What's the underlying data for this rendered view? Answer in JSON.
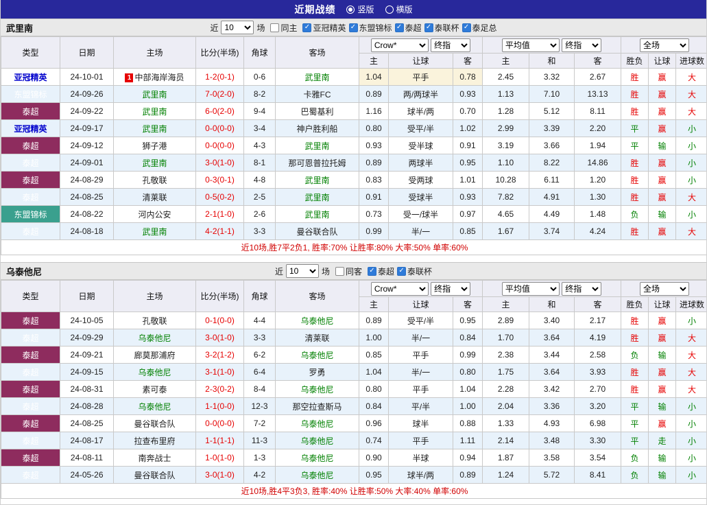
{
  "title_bar": {
    "title": "近期战绩",
    "options": [
      {
        "label": "竖版",
        "checked": true
      },
      {
        "label": "横版",
        "checked": false
      }
    ]
  },
  "colors": {
    "titlebar_bg": "#28289b",
    "thai_league_bg": "#8e2c5e",
    "asean_league_bg": "#3aa08e",
    "afc_league_text": "#0000cc",
    "focus_team_green": "#008000",
    "win_red": "#e60000",
    "lose_green": "#008000",
    "alt_row_bg": "#e8f2fb",
    "highlight_bg": "#faf3dc",
    "summary_red": "#d10000"
  },
  "sections": [
    {
      "team": "武里南",
      "filter": {
        "recent_label": "近",
        "recent_value": "10",
        "games_label": "场",
        "same_venue": {
          "label": "同主",
          "checked": false
        },
        "leagues": [
          {
            "label": "亚冠精英",
            "checked": true
          },
          {
            "label": "东盟锦标",
            "checked": true
          },
          {
            "label": "泰超",
            "checked": true
          },
          {
            "label": "泰联杯",
            "checked": true
          },
          {
            "label": "泰足总",
            "checked": true
          }
        ]
      },
      "header": {
        "type": "类型",
        "date": "日期",
        "home": "主场",
        "score": "比分(半场)",
        "corner": "角球",
        "away": "客场",
        "odds_select": "Crow*",
        "odds_close": "终指",
        "avg_select": "平均值",
        "avg_close": "终指",
        "full_select": "全场",
        "sub": [
          "主",
          "让球",
          "客",
          "主",
          "和",
          "客",
          "胜负",
          "让球",
          "进球数"
        ]
      },
      "rows": [
        {
          "league": "亚冠精英",
          "league_class": "afc",
          "date": "24-10-01",
          "badge": "1",
          "home": "中部海岸海员",
          "score": "1-2(0-1)",
          "corners": "0-6",
          "away": "武里南",
          "odds": [
            "1.04",
            "平手",
            "0.78"
          ],
          "avg": [
            "2.45",
            "3.32",
            "2.67"
          ],
          "results": [
            "胜",
            "赢",
            "大"
          ],
          "highlight": true
        },
        {
          "league": "东盟锦标",
          "league_class": "asean",
          "date": "24-09-26",
          "home": "武里南",
          "score": "7-0(2-0)",
          "corners": "8-2",
          "away": "卡雅FC",
          "odds": [
            "0.89",
            "两/两球半",
            "0.93"
          ],
          "avg": [
            "1.13",
            "7.10",
            "13.13"
          ],
          "results": [
            "胜",
            "赢",
            "大"
          ]
        },
        {
          "league": "泰超",
          "league_class": "thai",
          "date": "24-09-22",
          "home": "武里南",
          "score": "6-0(2-0)",
          "corners": "9-4",
          "away": "巴蜀基利",
          "odds": [
            "1.16",
            "球半/两",
            "0.70"
          ],
          "avg": [
            "1.28",
            "5.12",
            "8.11"
          ],
          "results": [
            "胜",
            "赢",
            "大"
          ]
        },
        {
          "league": "亚冠精英",
          "league_class": "afc",
          "date": "24-09-17",
          "home": "武里南",
          "score": "0-0(0-0)",
          "corners": "3-4",
          "away": "神户胜利船",
          "odds": [
            "0.80",
            "受平/半",
            "1.02"
          ],
          "avg": [
            "2.99",
            "3.39",
            "2.20"
          ],
          "results": [
            "平",
            "赢",
            "小"
          ]
        },
        {
          "league": "泰超",
          "league_class": "thai",
          "date": "24-09-12",
          "home": "狮子港",
          "score": "0-0(0-0)",
          "corners": "4-3",
          "away": "武里南",
          "odds": [
            "0.93",
            "受半球",
            "0.91"
          ],
          "avg": [
            "3.19",
            "3.66",
            "1.94"
          ],
          "results": [
            "平",
            "输",
            "小"
          ]
        },
        {
          "league": "泰超",
          "league_class": "thai",
          "date": "24-09-01",
          "home": "武里南",
          "score": "3-0(1-0)",
          "corners": "8-1",
          "away": "那可恩普拉托姆",
          "odds": [
            "0.89",
            "两球半",
            "0.95"
          ],
          "avg": [
            "1.10",
            "8.22",
            "14.86"
          ],
          "results": [
            "胜",
            "赢",
            "小"
          ]
        },
        {
          "league": "泰超",
          "league_class": "thai",
          "date": "24-08-29",
          "home": "孔敬联",
          "score": "0-3(0-1)",
          "corners": "4-8",
          "away": "武里南",
          "odds": [
            "0.83",
            "受两球",
            "1.01"
          ],
          "avg": [
            "10.28",
            "6.11",
            "1.20"
          ],
          "results": [
            "胜",
            "赢",
            "小"
          ]
        },
        {
          "league": "泰超",
          "league_class": "thai",
          "date": "24-08-25",
          "home": "清莱联",
          "score": "0-5(0-2)",
          "corners": "2-5",
          "away": "武里南",
          "odds": [
            "0.91",
            "受球半",
            "0.93"
          ],
          "avg": [
            "7.82",
            "4.91",
            "1.30"
          ],
          "results": [
            "胜",
            "赢",
            "大"
          ]
        },
        {
          "league": "东盟锦标",
          "league_class": "asean",
          "date": "24-08-22",
          "home": "河内公安",
          "score": "2-1(1-0)",
          "corners": "2-6",
          "away": "武里南",
          "odds": [
            "0.73",
            "受一/球半",
            "0.97"
          ],
          "avg": [
            "4.65",
            "4.49",
            "1.48"
          ],
          "results": [
            "负",
            "输",
            "小"
          ]
        },
        {
          "league": "泰超",
          "league_class": "thai",
          "date": "24-08-18",
          "home": "武里南",
          "score": "4-2(1-1)",
          "corners": "3-3",
          "away": "曼谷联合队",
          "odds": [
            "0.99",
            "半/一",
            "0.85"
          ],
          "avg": [
            "1.67",
            "3.74",
            "4.24"
          ],
          "results": [
            "胜",
            "赢",
            "大"
          ]
        }
      ],
      "summary": "近10场,胜7平2负1, 胜率:70% 让胜率:80% 大率:50% 单率:60%"
    },
    {
      "team": "乌泰他尼",
      "filter": {
        "recent_label": "近",
        "recent_value": "10",
        "games_label": "场",
        "same_venue": {
          "label": "同客",
          "checked": false
        },
        "leagues": [
          {
            "label": "泰超",
            "checked": true
          },
          {
            "label": "泰联杯",
            "checked": true
          }
        ]
      },
      "header": {
        "type": "类型",
        "date": "日期",
        "home": "主场",
        "score": "比分(半场)",
        "corner": "角球",
        "away": "客场",
        "odds_select": "Crow*",
        "odds_close": "终指",
        "avg_select": "平均值",
        "avg_close": "终指",
        "full_select": "全场",
        "sub": [
          "主",
          "让球",
          "客",
          "主",
          "和",
          "客",
          "胜负",
          "让球",
          "进球数"
        ]
      },
      "rows": [
        {
          "league": "泰超",
          "league_class": "thai",
          "date": "24-10-05",
          "home": "孔敬联",
          "score": "0-1(0-0)",
          "corners": "4-4",
          "away": "乌泰他尼",
          "odds": [
            "0.89",
            "受平/半",
            "0.95"
          ],
          "avg": [
            "2.89",
            "3.40",
            "2.17"
          ],
          "results": [
            "胜",
            "赢",
            "小"
          ]
        },
        {
          "league": "泰超",
          "league_class": "thai",
          "date": "24-09-29",
          "home": "乌泰他尼",
          "score": "3-0(1-0)",
          "corners": "3-3",
          "away": "清莱联",
          "odds": [
            "1.00",
            "半/一",
            "0.84"
          ],
          "avg": [
            "1.70",
            "3.64",
            "4.19"
          ],
          "results": [
            "胜",
            "赢",
            "大"
          ]
        },
        {
          "league": "泰超",
          "league_class": "thai",
          "date": "24-09-21",
          "home": "廊莫那浦府",
          "score": "3-2(1-2)",
          "corners": "6-2",
          "away": "乌泰他尼",
          "odds": [
            "0.85",
            "平手",
            "0.99"
          ],
          "avg": [
            "2.38",
            "3.44",
            "2.58"
          ],
          "results": [
            "负",
            "输",
            "大"
          ]
        },
        {
          "league": "泰超",
          "league_class": "thai",
          "date": "24-09-15",
          "home": "乌泰他尼",
          "score": "3-1(1-0)",
          "corners": "6-4",
          "away": "罗勇",
          "odds": [
            "1.04",
            "半/一",
            "0.80"
          ],
          "avg": [
            "1.75",
            "3.64",
            "3.93"
          ],
          "results": [
            "胜",
            "赢",
            "大"
          ]
        },
        {
          "league": "泰超",
          "league_class": "thai",
          "date": "24-08-31",
          "home": "素可泰",
          "score": "2-3(0-2)",
          "corners": "8-4",
          "away": "乌泰他尼",
          "odds": [
            "0.80",
            "平手",
            "1.04"
          ],
          "avg": [
            "2.28",
            "3.42",
            "2.70"
          ],
          "results": [
            "胜",
            "赢",
            "大"
          ]
        },
        {
          "league": "泰超",
          "league_class": "thai",
          "date": "24-08-28",
          "home": "乌泰他尼",
          "score": "1-1(0-0)",
          "corners": "12-3",
          "away": "那空拉查斯马",
          "odds": [
            "0.84",
            "平/半",
            "1.00"
          ],
          "avg": [
            "2.04",
            "3.36",
            "3.20"
          ],
          "results": [
            "平",
            "输",
            "小"
          ]
        },
        {
          "league": "泰超",
          "league_class": "thai",
          "date": "24-08-25",
          "home": "曼谷联合队",
          "score": "0-0(0-0)",
          "corners": "7-2",
          "away": "乌泰他尼",
          "odds": [
            "0.96",
            "球半",
            "0.88"
          ],
          "avg": [
            "1.33",
            "4.93",
            "6.98"
          ],
          "results": [
            "平",
            "赢",
            "小"
          ]
        },
        {
          "league": "泰超",
          "league_class": "thai",
          "date": "24-08-17",
          "home": "拉查布里府",
          "score": "1-1(1-1)",
          "corners": "11-3",
          "away": "乌泰他尼",
          "odds": [
            "0.74",
            "平手",
            "1.11"
          ],
          "avg": [
            "2.14",
            "3.48",
            "3.30"
          ],
          "results": [
            "平",
            "走",
            "小"
          ]
        },
        {
          "league": "泰超",
          "league_class": "thai",
          "date": "24-08-11",
          "home": "南奔战士",
          "score": "1-0(1-0)",
          "corners": "1-3",
          "away": "乌泰他尼",
          "odds": [
            "0.90",
            "半球",
            "0.94"
          ],
          "avg": [
            "1.87",
            "3.58",
            "3.54"
          ],
          "results": [
            "负",
            "输",
            "小"
          ]
        },
        {
          "league": "泰超",
          "league_class": "thai",
          "date": "24-05-26",
          "home": "曼谷联合队",
          "score": "3-0(1-0)",
          "corners": "4-2",
          "away": "乌泰他尼",
          "odds": [
            "0.95",
            "球半/两",
            "0.89"
          ],
          "avg": [
            "1.24",
            "5.72",
            "8.41"
          ],
          "results": [
            "负",
            "输",
            "小"
          ]
        }
      ],
      "summary": "近10场,胜4平3负3, 胜率:40% 让胜率:50% 大率:40% 单率:60%"
    }
  ]
}
